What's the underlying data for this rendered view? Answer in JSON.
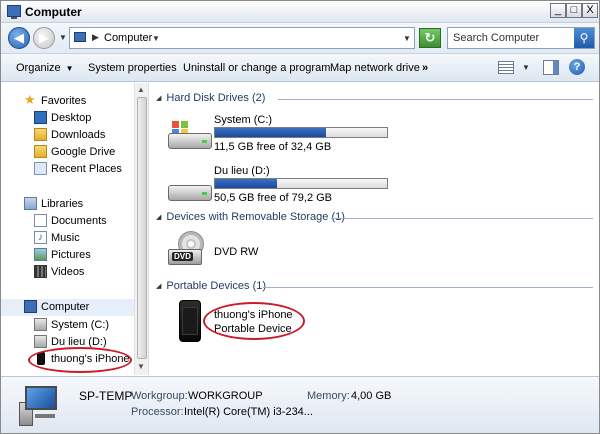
{
  "window": {
    "title": "Computer"
  },
  "titlebar_buttons": {
    "min": "_",
    "max": "□",
    "close": "X"
  },
  "address": {
    "path_label": "Computer",
    "search_placeholder": "Search Computer"
  },
  "toolbar": {
    "organize": "Organize",
    "system_properties": "System properties",
    "uninstall": "Uninstall or change a program",
    "map_network": "Map network drive",
    "more": "»"
  },
  "nav": {
    "favorites": "Favorites",
    "desktop": "Desktop",
    "downloads": "Downloads",
    "google_drive": "Google Drive",
    "recent_places": "Recent Places",
    "libraries": "Libraries",
    "documents": "Documents",
    "music": "Music",
    "pictures": "Pictures",
    "videos": "Videos",
    "computer": "Computer",
    "system_c": "System (C:)",
    "du_lieu_d": "Du lieu (D:)",
    "iphone": "thuong's iPhone"
  },
  "groups": {
    "hdd": "Hard Disk Drives (2)",
    "removable": "Devices with Removable Storage (1)",
    "portable": "Portable Devices (1)"
  },
  "drives": [
    {
      "name": "System (C:)",
      "free": "11,5 GB free of 32,4 GB",
      "used_fraction": 0.645
    },
    {
      "name": "Du lieu (D:)",
      "free": "50,5 GB free of 79,2 GB",
      "used_fraction": 0.362
    }
  ],
  "dvd": {
    "name": "DVD RW",
    "badge": "DVD"
  },
  "portable": {
    "name": "thuong's iPhone",
    "type": "Portable Device"
  },
  "details": {
    "computer_name": "SP-TEMP",
    "workgroup_label": "Workgroup:",
    "workgroup_value": "WORKGROUP",
    "memory_label": "Memory:",
    "memory_value": "4,00 GB",
    "processor_label": "Processor:",
    "processor_value": "Intel(R) Core(TM) i3-234..."
  },
  "colors": {
    "highlight_ellipse": "#cc1a2b",
    "drive_bar": "#1c4a9a"
  }
}
